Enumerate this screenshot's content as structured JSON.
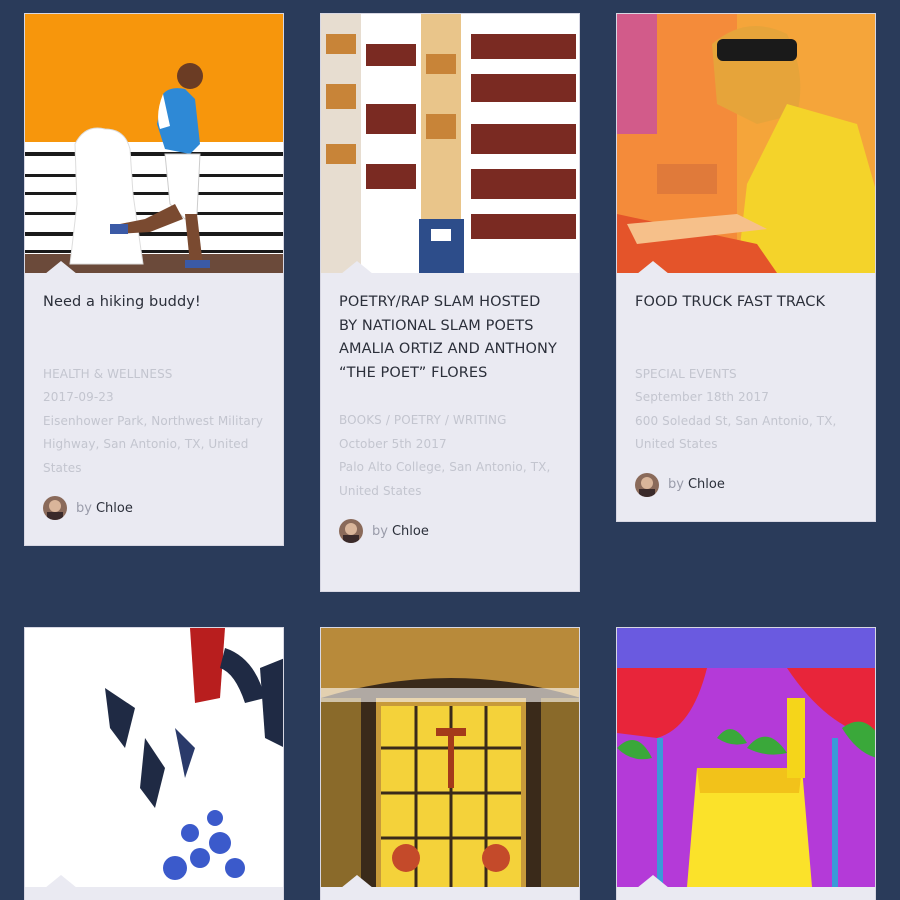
{
  "cards": [
    {
      "image": "runner-photo",
      "title": "Need a hiking buddy!",
      "category": "HEALTH & WELLNESS",
      "date": "2017-09-23",
      "location": "Eisenhower Park, Northwest Military Highway, San Antonio, TX, United States",
      "by_label": "by",
      "author": "Chloe"
    },
    {
      "image": "bookshelf-photo",
      "title": "POETRY/RAP SLAM HOSTED BY NATIONAL SLAM POETS AMALIA ORTIZ AND ANTHONY “THE POET” FLORES",
      "category": "BOOKS / POETRY / WRITING",
      "date": "October 5th 2017",
      "location": "Palo Alto College, San Antonio, TX, United States",
      "by_label": "by",
      "author": "Chloe"
    },
    {
      "image": "man-sunglasses-photo",
      "title": "FOOD TRUCK FAST TRACK",
      "category": "SPECIAL EVENTS",
      "date": "September 18th 2017",
      "location": "600 Soledad St, San Antonio, TX, United States",
      "by_label": "by",
      "author": "Chloe"
    },
    {
      "image": "abstract-photo"
    },
    {
      "image": "stained-glass-photo"
    },
    {
      "image": "cocktails-photo"
    }
  ],
  "colors": {
    "background": "#2a3b5a",
    "card": "#eaeaf2",
    "title": "#2b2f3a",
    "meta": "#c3c5cf"
  }
}
